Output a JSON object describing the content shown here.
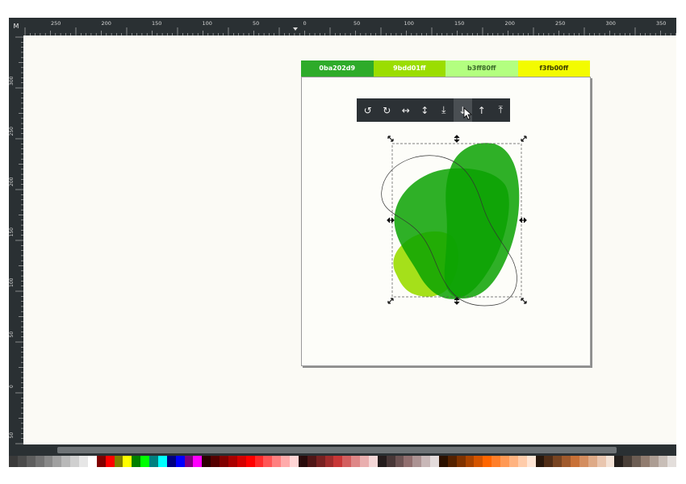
{
  "ruler": {
    "corner_label": "M",
    "top_labels": [
      "250",
      "200",
      "150",
      "100",
      "50",
      "0",
      "50",
      "100",
      "150",
      "200",
      "250",
      "300",
      "350"
    ],
    "left_labels": [
      "300",
      "250",
      "200",
      "150",
      "100",
      "50",
      "0",
      "50",
      "100"
    ]
  },
  "swatches": [
    {
      "label": "0ba202d9",
      "color": "#2eab2a",
      "text_color": "#ffffff"
    },
    {
      "label": "9bdd01ff",
      "color": "#9bdd01",
      "text_color": "#ffffff"
    },
    {
      "label": "b3ff80ff",
      "color": "#b3ff80",
      "text_color": "#3a6a2a"
    },
    {
      "label": "f3fb00ff",
      "color": "#f3fb00",
      "text_color": "#3a3a00"
    }
  ],
  "toolbar": {
    "buttons": [
      {
        "name": "rotate-ccw-button",
        "icon": "↺"
      },
      {
        "name": "rotate-cw-button",
        "icon": "↻"
      },
      {
        "name": "flip-horizontal-button",
        "icon": "↔"
      },
      {
        "name": "flip-vertical-button",
        "icon": "↕"
      },
      {
        "name": "lower-to-bottom-button",
        "icon": "⤓"
      },
      {
        "name": "lower-button",
        "icon": "↓"
      },
      {
        "name": "raise-button",
        "icon": "↑"
      },
      {
        "name": "raise-to-top-button",
        "icon": "⤒"
      }
    ],
    "active_index": 5
  },
  "palette": [
    "#3a3a3a",
    "#4a4a4a",
    "#5e5e5e",
    "#727272",
    "#888888",
    "#a0a0a0",
    "#b8b8b8",
    "#cfcfcf",
    "#e6e6e6",
    "#ffffff",
    "#800000",
    "#ff0000",
    "#808000",
    "#ffff00",
    "#008000",
    "#00ff00",
    "#008080",
    "#00ffff",
    "#000080",
    "#0000ff",
    "#800080",
    "#ff00ff",
    "#2b0000",
    "#550000",
    "#800000",
    "#aa0000",
    "#d40000",
    "#ff0000",
    "#ff2a2a",
    "#ff5555",
    "#ff8080",
    "#ffaaaa",
    "#ffd5d5",
    "#280b0b",
    "#501616",
    "#782121",
    "#a02c2c",
    "#c83737",
    "#d35f5f",
    "#de8787",
    "#e9afaf",
    "#f4d7d7",
    "#241c1c",
    "#483737",
    "#6c5353",
    "#916f6f",
    "#ac9393",
    "#c8b7b7",
    "#e3dbdb",
    "#2b1100",
    "#552200",
    "#803300",
    "#aa4400",
    "#d45500",
    "#ff6600",
    "#ff7f2a",
    "#ff9955",
    "#ffb380",
    "#ffccaa",
    "#ffe6d5",
    "#28170b",
    "#502d16",
    "#784421",
    "#a05a2c",
    "#c87137",
    "#d38d5f",
    "#deaa87",
    "#e9c6af",
    "#f4e3d7",
    "#241f1c",
    "#483e37",
    "#6c5d53",
    "#917c6f",
    "#ac9d93",
    "#c8beb7",
    "#e3dedb"
  ],
  "colors": {
    "shape_main": "#0ba202",
    "shape_yellowgreen": "#9bdd01",
    "selection_dash": "#555555"
  }
}
